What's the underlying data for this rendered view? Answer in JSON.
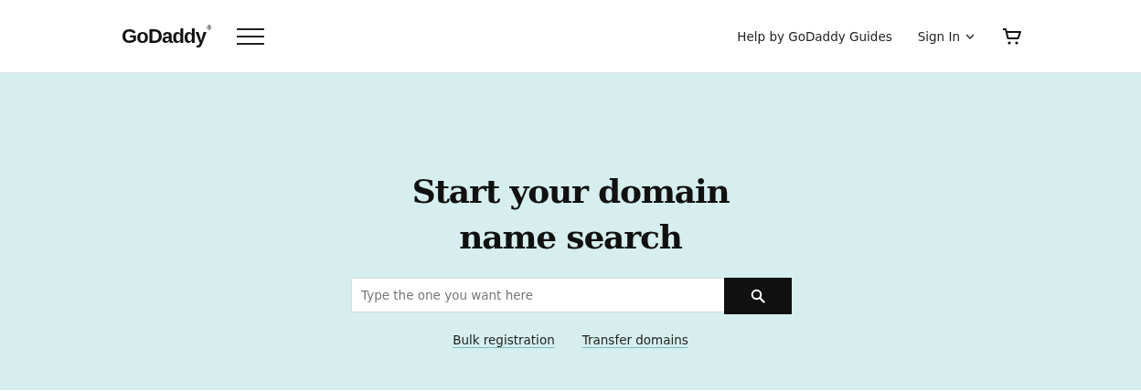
{
  "header": {
    "logo": {
      "text": "GoDaddy",
      "mark": "®"
    },
    "nav": [
      {
        "label": "Help by GoDaddy Guides",
        "kind": "link"
      },
      {
        "label": "Sign In",
        "kind": "dropdown"
      },
      {
        "kind": "cart"
      }
    ]
  },
  "hero": {
    "title_lines": [
      "Start your domain",
      "name search"
    ],
    "search": {
      "placeholder": "Type the one you want here"
    },
    "links": [
      "Bulk registration",
      "Transfer domains"
    ]
  }
}
